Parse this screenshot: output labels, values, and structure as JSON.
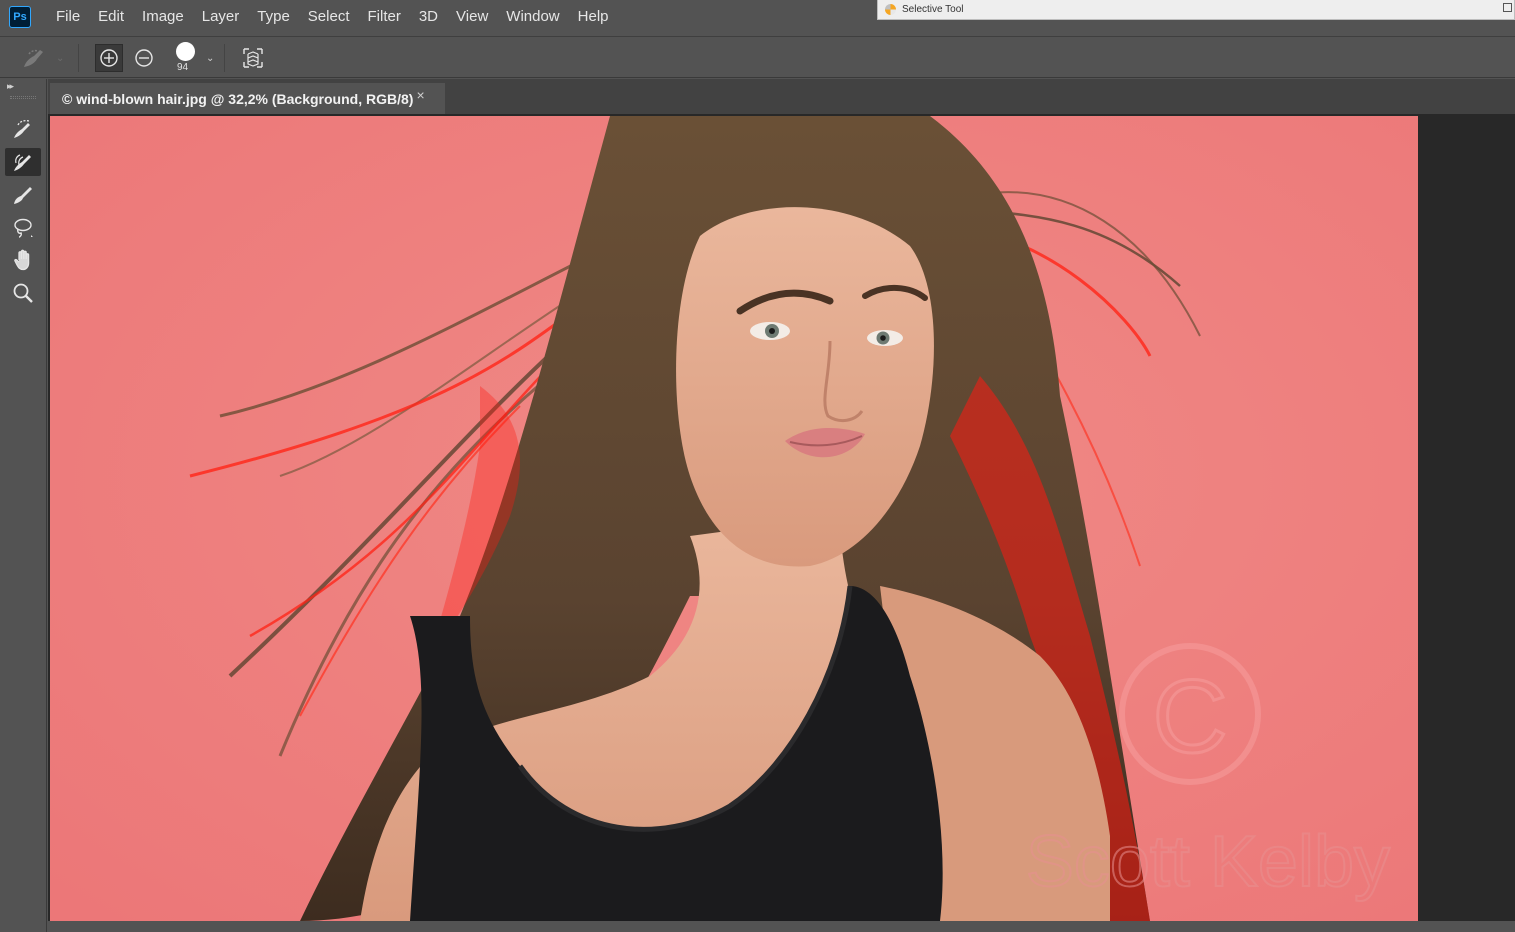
{
  "app": {
    "logo_text": "Ps"
  },
  "menu": [
    "File",
    "Edit",
    "Image",
    "Layer",
    "Type",
    "Select",
    "Filter",
    "3D",
    "View",
    "Window",
    "Help"
  ],
  "floating_window": {
    "title": "Selective Tool"
  },
  "options_bar": {
    "tool_icon": "quick-selection-brush-icon",
    "modes": [
      {
        "name": "add-to-selection-icon",
        "active": true
      },
      {
        "name": "subtract-from-selection-icon",
        "active": false
      }
    ],
    "brush_size": "94",
    "refine_icon": "refine-edge-icon"
  },
  "toolbar": {
    "tools": [
      {
        "name": "quick-selection-tool",
        "icon": "quick-selection-icon",
        "active": false
      },
      {
        "name": "refine-edge-brush-tool",
        "icon": "refine-edge-brush-icon",
        "active": true
      },
      {
        "name": "brush-tool",
        "icon": "brush-icon",
        "active": false
      },
      {
        "name": "lasso-tool",
        "icon": "lasso-icon",
        "active": false
      },
      {
        "name": "hand-tool",
        "icon": "hand-icon",
        "active": false
      },
      {
        "name": "zoom-tool",
        "icon": "zoom-icon",
        "active": false
      }
    ]
  },
  "document": {
    "tab_title": "© wind-blown hair.jpg @ 32,2% (Background, RGB/8)",
    "tab_close": "×"
  },
  "canvas": {
    "description_colors": {
      "background": "#ee7d7d",
      "overlay_red": "#ff1a10",
      "hair": "#5a4330",
      "skin": "#e3a98d",
      "top": "#1b1b1d"
    },
    "watermark": "Scott Kelby",
    "watermark_symbol": "C"
  },
  "colors": {
    "ui_bg": "#535353",
    "ui_dark": "#282828",
    "accent": "#31a8ff"
  }
}
